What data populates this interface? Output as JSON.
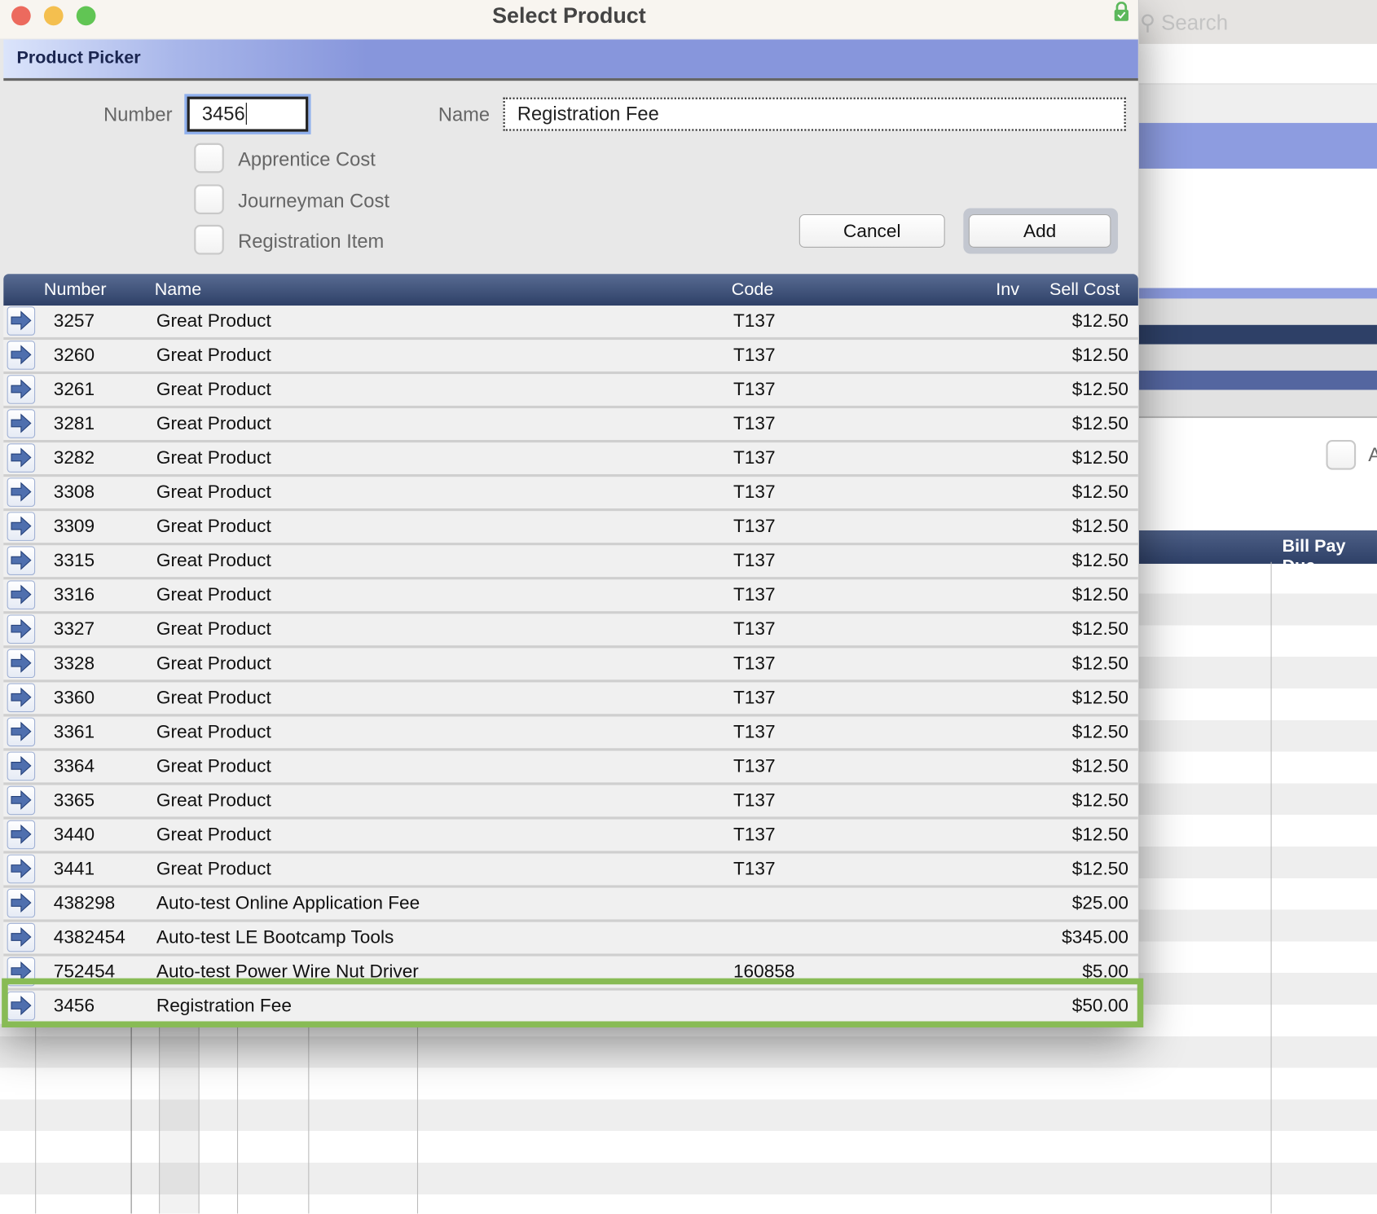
{
  "window": {
    "title": "Select Product"
  },
  "background": {
    "search_placeholder": "Search",
    "column_header": "Bill Pay Due",
    "checkbox_label": "A"
  },
  "banner": {
    "title": "Product Picker"
  },
  "form": {
    "number_label": "Number",
    "number_value": "3456",
    "name_label": "Name",
    "name_value": "Registration Fee",
    "checkboxes": [
      {
        "label": "Apprentice Cost",
        "checked": false
      },
      {
        "label": "Journeyman Cost",
        "checked": false
      },
      {
        "label": "Registration Item",
        "checked": false
      }
    ],
    "cancel_label": "Cancel",
    "add_label": "Add"
  },
  "table": {
    "columns": [
      "Number",
      "Name",
      "Code",
      "Inv",
      "Sell Cost"
    ],
    "rows": [
      {
        "number": "3257",
        "name": "Great Product",
        "code": "T137",
        "inv": "",
        "sell": "$12.50"
      },
      {
        "number": "3260",
        "name": "Great Product",
        "code": "T137",
        "inv": "",
        "sell": "$12.50"
      },
      {
        "number": "3261",
        "name": "Great Product",
        "code": "T137",
        "inv": "",
        "sell": "$12.50"
      },
      {
        "number": "3281",
        "name": "Great Product",
        "code": "T137",
        "inv": "",
        "sell": "$12.50"
      },
      {
        "number": "3282",
        "name": "Great Product",
        "code": "T137",
        "inv": "",
        "sell": "$12.50"
      },
      {
        "number": "3308",
        "name": "Great Product",
        "code": "T137",
        "inv": "",
        "sell": "$12.50"
      },
      {
        "number": "3309",
        "name": "Great Product",
        "code": "T137",
        "inv": "",
        "sell": "$12.50"
      },
      {
        "number": "3315",
        "name": "Great Product",
        "code": "T137",
        "inv": "",
        "sell": "$12.50"
      },
      {
        "number": "3316",
        "name": "Great Product",
        "code": "T137",
        "inv": "",
        "sell": "$12.50"
      },
      {
        "number": "3327",
        "name": "Great Product",
        "code": "T137",
        "inv": "",
        "sell": "$12.50"
      },
      {
        "number": "3328",
        "name": "Great Product",
        "code": "T137",
        "inv": "",
        "sell": "$12.50"
      },
      {
        "number": "3360",
        "name": "Great Product",
        "code": "T137",
        "inv": "",
        "sell": "$12.50"
      },
      {
        "number": "3361",
        "name": "Great Product",
        "code": "T137",
        "inv": "",
        "sell": "$12.50"
      },
      {
        "number": "3364",
        "name": "Great Product",
        "code": "T137",
        "inv": "",
        "sell": "$12.50"
      },
      {
        "number": "3365",
        "name": "Great Product",
        "code": "T137",
        "inv": "",
        "sell": "$12.50"
      },
      {
        "number": "3440",
        "name": "Great Product",
        "code": "T137",
        "inv": "",
        "sell": "$12.50"
      },
      {
        "number": "3441",
        "name": "Great Product",
        "code": "T137",
        "inv": "",
        "sell": "$12.50"
      },
      {
        "number": "438298",
        "name": "Auto-test Online Application Fee",
        "code": "",
        "inv": "",
        "sell": "$25.00"
      },
      {
        "number": "4382454",
        "name": "Auto-test LE Bootcamp Tools",
        "code": "",
        "inv": "",
        "sell": "$345.00"
      },
      {
        "number": "752454",
        "name": "Auto-test Power Wire Nut Driver",
        "code": "160858",
        "inv": "",
        "sell": "$5.00"
      },
      {
        "number": "3456",
        "name": "Registration Fee",
        "code": "",
        "inv": "",
        "sell": "$50.00",
        "highlighted": true
      }
    ]
  },
  "colors": {
    "highlight": "#88bb55",
    "banner": "#8796dc",
    "header": "#2e4067"
  }
}
